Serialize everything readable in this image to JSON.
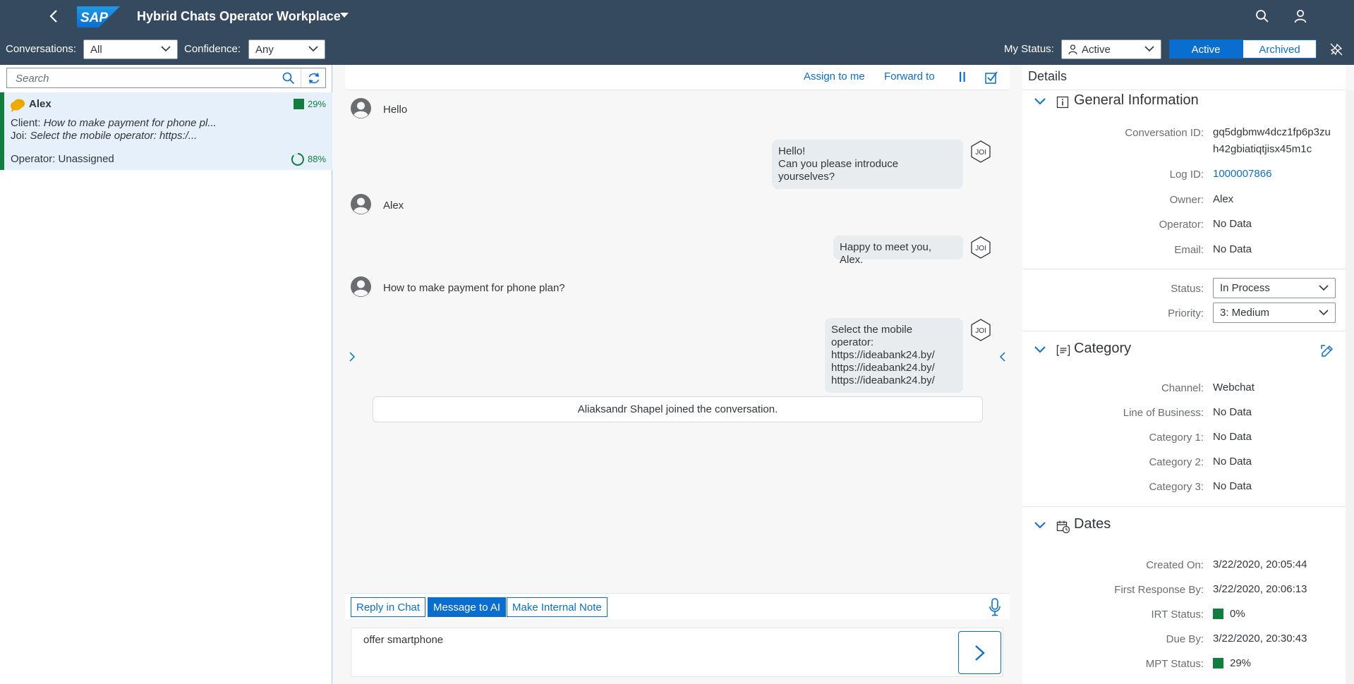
{
  "shell": {
    "title": "Hybrid Chats Operator Workplace",
    "logo_text": "SAP",
    "icons": [
      "back-icon",
      "chevron-down-icon",
      "search-icon",
      "user-icon"
    ]
  },
  "filters": {
    "conversations_label": "Conversations:",
    "conversations_value": "All",
    "confidence_label": "Confidence:",
    "confidence_value": "Any",
    "my_status_label": "My Status:",
    "my_status_value": "Active",
    "seg_active": "Active",
    "seg_archived": "Archived"
  },
  "list": {
    "search_placeholder": "Search",
    "conversation": {
      "name": "Alex",
      "confidence_pct": "29%",
      "client_label": "Client:",
      "client_text": "How to make payment for phone pl...",
      "joi_label": "Joi:",
      "joi_text": "Select the mobile operator: https:/...",
      "operator_text": "Operator: Unassigned",
      "progress_pct": "88%"
    }
  },
  "chat": {
    "toolbar": {
      "assign": "Assign to me",
      "forward": "Forward to"
    },
    "messages": {
      "m1": "Hello",
      "m2_l1": "Hello!",
      "m2_l2": "Can you please introduce yourselves?",
      "m3": "Alex",
      "m4": "Happy to meet you, Alex.",
      "m5": "How to make payment for phone plan?",
      "m6_l1": "Select the mobile operator:",
      "m6_l2": "https://ideabank24.by/",
      "m6_l3": "https://ideabank24.by/",
      "m6_l4": "https://ideabank24.by/",
      "system": "Aliaksandr Shapel joined the conversation.",
      "bot_badge": "JOI"
    },
    "tabs": {
      "reply": "Reply in Chat",
      "ai": "Message to AI",
      "note": "Make Internal Note"
    },
    "input_value": "offer  smartphone"
  },
  "details": {
    "title": "Details",
    "general": {
      "heading": "General Information",
      "conv_id_label": "Conversation ID:",
      "conv_id_l1": "gq5dgbmw4dcz1fp6p3zu",
      "conv_id_l2": "h42gbiatiqtjisx45m1c",
      "log_id_label": "Log ID:",
      "log_id": "1000007866",
      "owner_label": "Owner:",
      "owner": "Alex",
      "operator_label": "Operator:",
      "operator": "No Data",
      "email_label": "Email:",
      "email": "No Data",
      "status_label": "Status:",
      "status": "In Process",
      "priority_label": "Priority:",
      "priority": "3: Medium"
    },
    "category": {
      "heading": "Category",
      "channel_label": "Channel:",
      "channel": "Webchat",
      "lob_label": "Line of Business:",
      "lob": "No Data",
      "cat1_label": "Category 1:",
      "cat1": "No Data",
      "cat2_label": "Category 2:",
      "cat2": "No Data",
      "cat3_label": "Category 3:",
      "cat3": "No Data"
    },
    "dates": {
      "heading": "Dates",
      "created_label": "Created On:",
      "created": "3/22/2020, 20:05:44",
      "first_resp_label": "First Response By:",
      "first_resp": "3/22/2020, 20:06:13",
      "irt_label": "IRT Status:",
      "irt": "0%",
      "due_label": "Due By:",
      "due": "3/22/2020, 20:30:43",
      "mpt_label": "MPT Status:",
      "mpt": "29%"
    }
  },
  "colors": {
    "shell": "#354a5f",
    "accent": "#0a6ed1",
    "success": "#107e3e",
    "sap_blue": "#0a6ed1"
  }
}
